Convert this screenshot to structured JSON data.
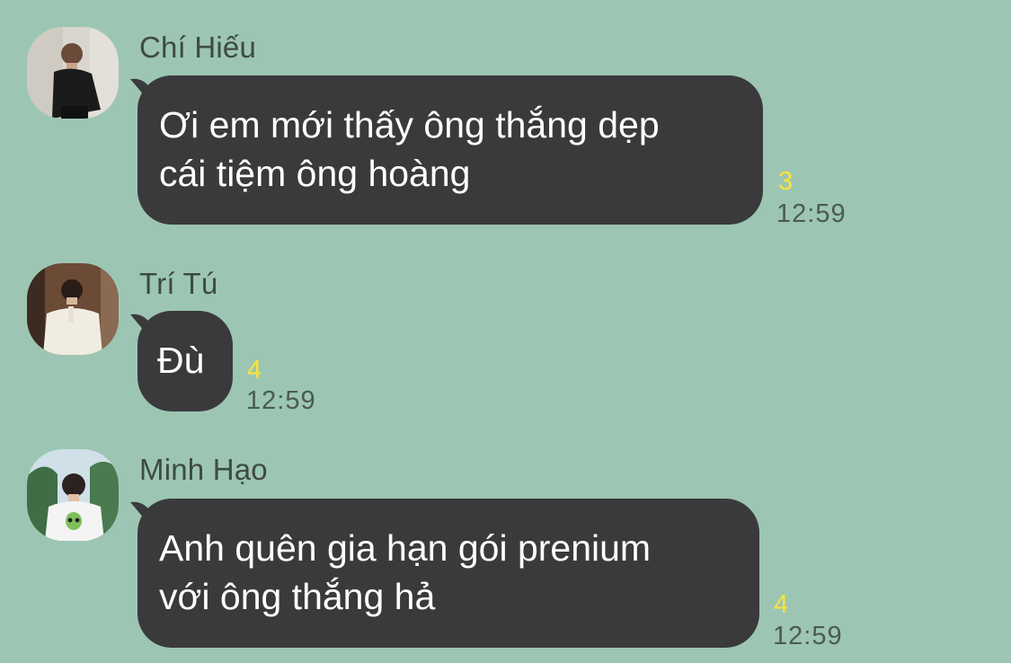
{
  "colors": {
    "background": "#9cc6b3",
    "bubble": "#3a3a3c",
    "bubble_text": "#ffffff",
    "unread": "#ffe23a",
    "sender": "#3e4a44",
    "time": "#4c5a53"
  },
  "messages": [
    {
      "sender": "Chí Hiếu",
      "text": "Ơi em mới thấy ông thắng dẹp\ncái tiệm ông hoàng",
      "unread": "3",
      "time": "12:59",
      "avatar_icon": "user-avatar-icon"
    },
    {
      "sender": "Trí Tú",
      "text": "Đù",
      "unread": "4",
      "time": "12:59",
      "avatar_icon": "user-avatar-icon"
    },
    {
      "sender": "Minh Hạo",
      "text": "Anh quên gia hạn gói prenium\nvới ông thắng hả",
      "unread": "4",
      "time": "12:59",
      "avatar_icon": "user-avatar-icon"
    }
  ]
}
